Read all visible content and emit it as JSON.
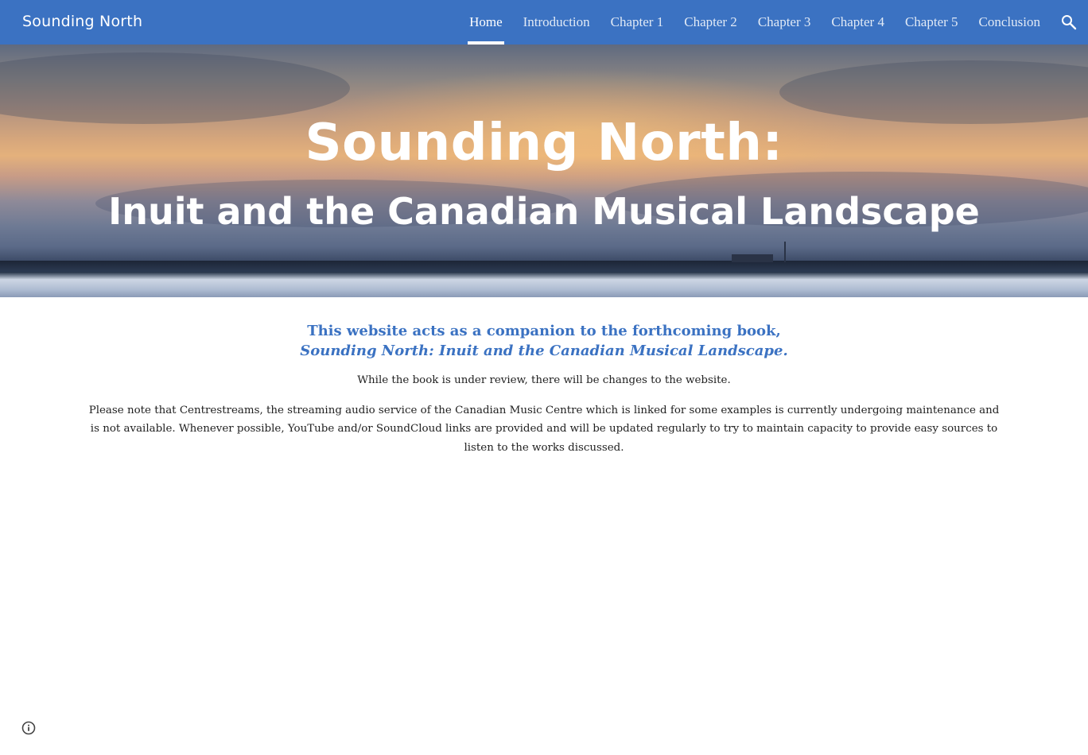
{
  "header": {
    "site_title": "Sounding North",
    "nav_items": [
      {
        "label": "Home",
        "active": true
      },
      {
        "label": "Introduction",
        "active": false
      },
      {
        "label": "Chapter 1",
        "active": false
      },
      {
        "label": "Chapter 2",
        "active": false
      },
      {
        "label": "Chapter 3",
        "active": false
      },
      {
        "label": "Chapter 4",
        "active": false
      },
      {
        "label": "Chapter 5",
        "active": false
      },
      {
        "label": "Conclusion",
        "active": false
      }
    ],
    "search_icon": "search-icon"
  },
  "hero": {
    "title": "Sounding North:",
    "subtitle": "Inuit and the Canadian Musical Landscape"
  },
  "main": {
    "lead_line1": "This website acts as a companion to the forthcoming book,",
    "lead_line2": "Sounding North: Inuit and the Canadian Musical Landscape.",
    "note_review": "While the book is under review, there will be changes to the website.",
    "note_centrestreams": "Please note that Centrestreams, the streaming audio service of the Canadian Music Centre which is linked for some examples is currently undergoing maintenance and is not available.  Whenever possible, YouTube and/or SoundCloud links are provided and will be updated regularly to try to maintain capacity to provide easy sources to listen to the works discussed."
  },
  "footer": {
    "info_icon": "info-icon"
  },
  "colors": {
    "brand": "#3b72c2",
    "text": "#212121",
    "header_text": "#ffffff"
  }
}
